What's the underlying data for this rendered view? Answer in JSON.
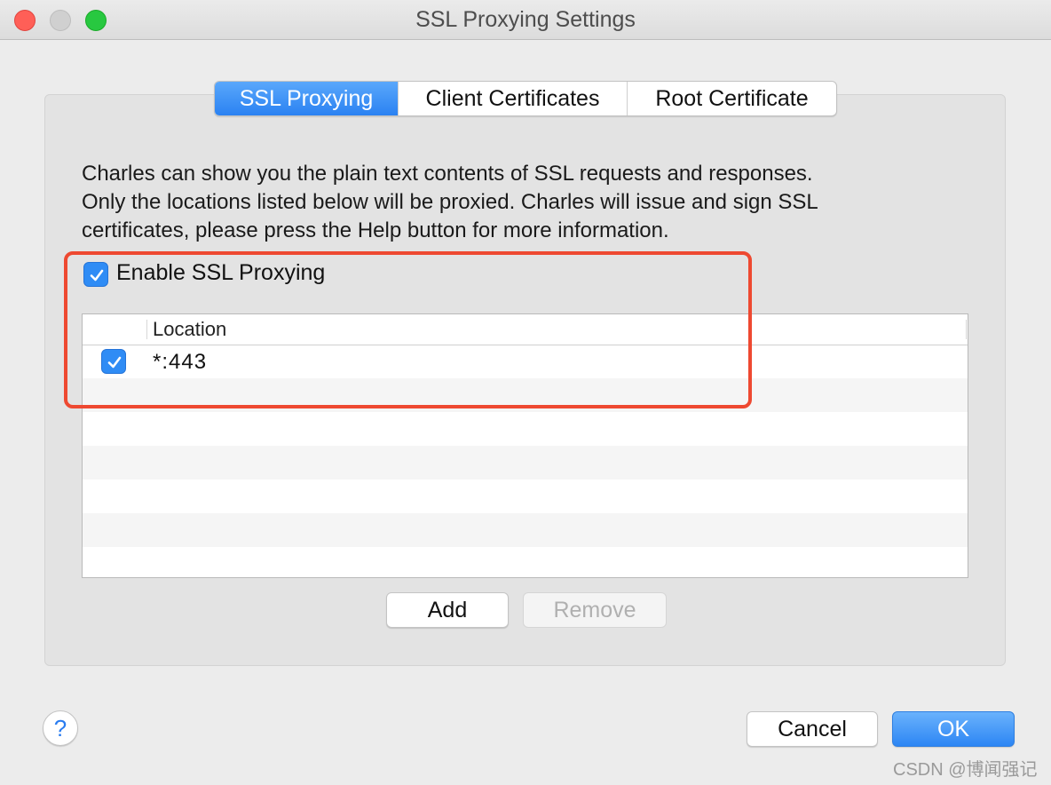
{
  "window": {
    "title": "SSL Proxying Settings"
  },
  "tabs": [
    {
      "label": "SSL Proxying",
      "active": true
    },
    {
      "label": "Client Certificates",
      "active": false
    },
    {
      "label": "Root Certificate",
      "active": false
    }
  ],
  "description": {
    "lines": [
      "Charles can show you the plain text contents of SSL requests and responses.",
      "Only the locations listed below will be proxied. Charles will issue and sign SSL",
      "certificates, please press the Help button for more information."
    ]
  },
  "enable_ssl_proxying": {
    "label": "Enable SSL Proxying",
    "checked": true
  },
  "locations_table": {
    "column_header": "Location",
    "rows": [
      {
        "checked": true,
        "location": "*:443"
      }
    ]
  },
  "buttons": {
    "add": "Add",
    "remove": "Remove",
    "cancel": "Cancel",
    "ok": "OK",
    "help": "?"
  },
  "colors": {
    "accent": "#2f8cf5",
    "highlight": "#ee4931"
  },
  "watermark": "CSDN @博闻强记"
}
